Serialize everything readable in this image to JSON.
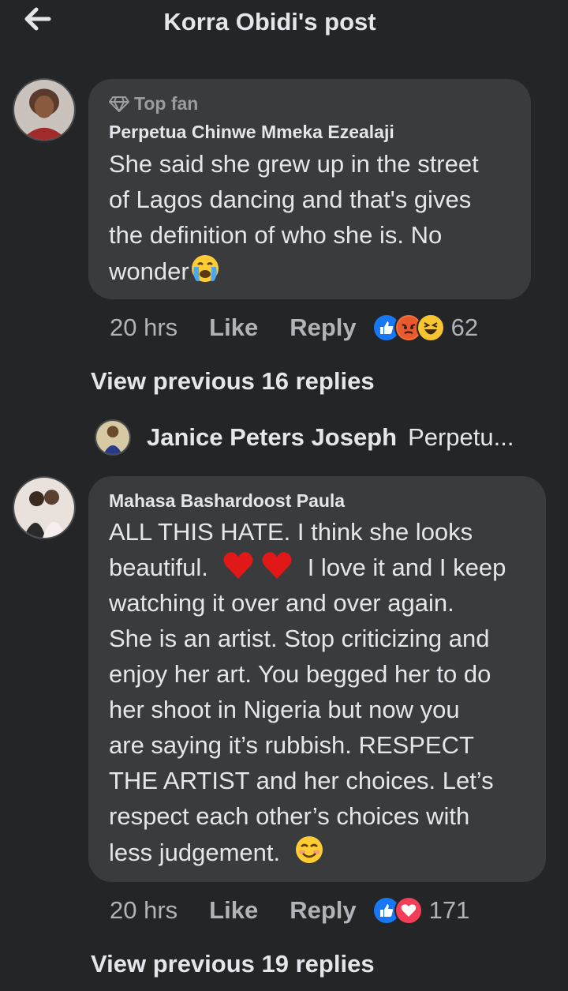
{
  "header": {
    "title": "Korra Obidi's post"
  },
  "comments": [
    {
      "badge": "Top fan",
      "author": "Perpetua Chinwe Mmeka Ezealaji",
      "lines": [
        "She said she grew up in the street",
        "of Lagos dancing and that's gives",
        "the definition of who she is. No",
        "wonder"
      ],
      "time": "20 hrs",
      "like_label": "Like",
      "reply_label": "Reply",
      "reaction_count": "62",
      "reactions": [
        "like-icon",
        "angry-icon",
        "haha-icon"
      ],
      "view_previous": "View previous 16 replies",
      "reply_preview": {
        "name": "Janice Peters Joseph",
        "snippet": "Perpetu..."
      }
    },
    {
      "author": "Mahasa Bashardoost Paula",
      "lines": [
        "ALL THIS HATE. I think she looks",
        "beautiful.",
        "watching it over and over again.",
        "She is an artist. Stop criticizing and",
        "enjoy her art. You begged her to do",
        "her shoot in Nigeria but now you",
        "are saying it’s rubbish. RESPECT",
        "THE ARTIST and her choices. Let’s",
        "respect each other’s choices with",
        "less judgement."
      ],
      "line2_suffix": "I love it and I keep",
      "time": "20 hrs",
      "like_label": "Like",
      "reply_label": "Reply",
      "reaction_count": "171",
      "reactions": [
        "like-icon",
        "love-icon"
      ],
      "view_previous": "View previous 19 replies"
    }
  ],
  "colors": {
    "background": "#242526",
    "bubble": "#3a3b3c",
    "text": "#e4e6eb",
    "muted": "#b0b3b8",
    "like_blue": "#1877f2",
    "love_red": "#f33e58"
  }
}
